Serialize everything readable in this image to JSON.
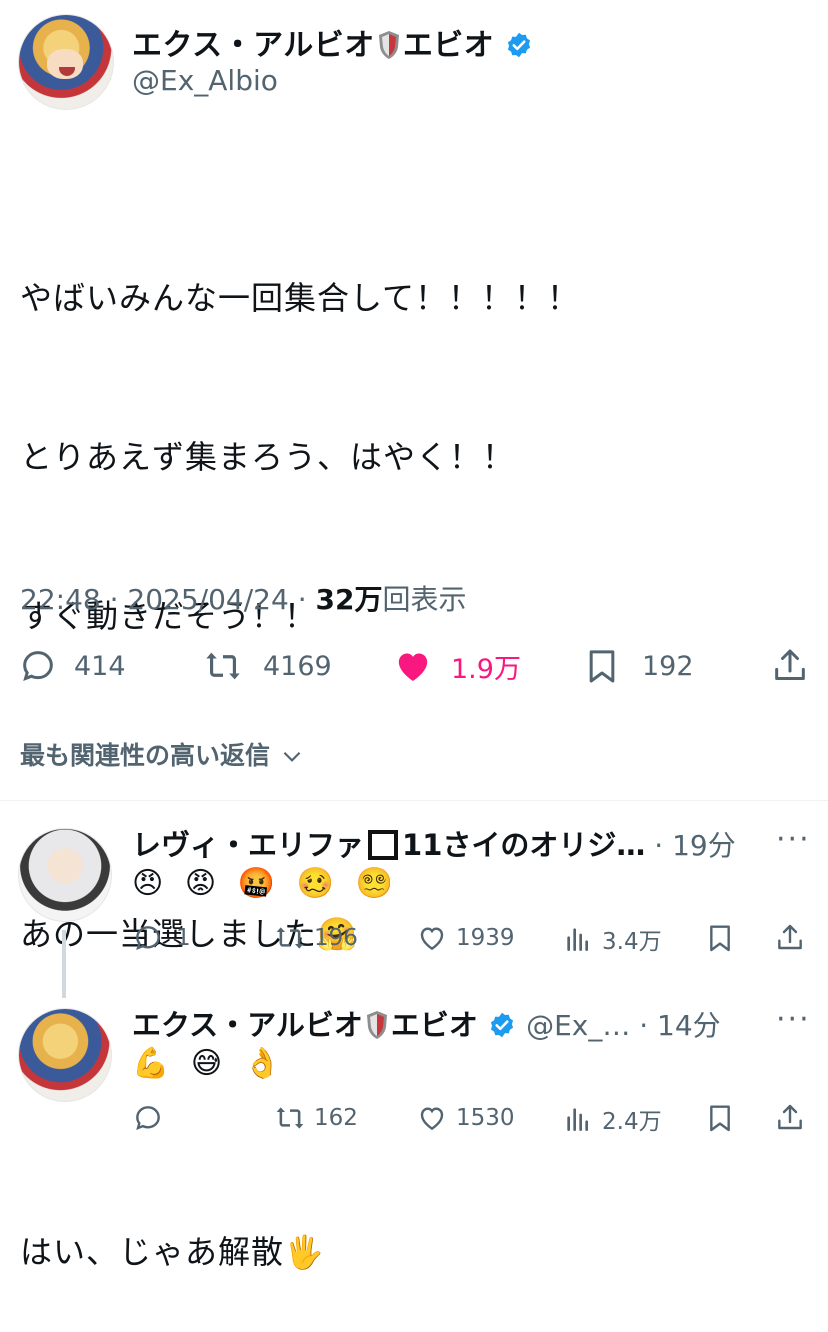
{
  "tweet": {
    "display_name": "エクス・アルビオ",
    "display_name_suffix": "エビオ",
    "handle": "@Ex_Albio",
    "lines": [
      "やばいみんな一回集合して！！！！！",
      "とりあえず集まろう、はやく！！",
      "すぐ動きだそう！！",
      "",
      "あの一当選しました🤗",
      "",
      "はい、じゃあ解散🖐"
    ],
    "time": "22:48",
    "date": "2025/04/24",
    "views_count": "32万",
    "views_label": "回表示",
    "replies": "414",
    "retweets": "4169",
    "likes": "1.9万",
    "bookmarks": "192"
  },
  "related_label": "最も関連性の高い返信",
  "replies": [
    {
      "name": "レヴィ・エリファ",
      "name_suffix": "11さイのオリジ…",
      "time": "19分",
      "emojis": [
        "😠",
        "😡",
        "🤬",
        "🥴",
        "😵‍💫"
      ],
      "replies": "1",
      "retweets": "196",
      "likes": "1939",
      "views": "3.4万"
    },
    {
      "name": "エクス・アルビオ",
      "name_suffix": "エビオ",
      "handle": "@Ex_…",
      "time": "14分",
      "emojis": [
        "💪",
        "😅",
        "👌"
      ],
      "replies": "",
      "retweets": "162",
      "likes": "1530",
      "views": "2.4万"
    }
  ],
  "colors": {
    "text": "#0f1419",
    "secondary": "#536471",
    "like": "#f91880",
    "verified": "#1d9bf0"
  }
}
